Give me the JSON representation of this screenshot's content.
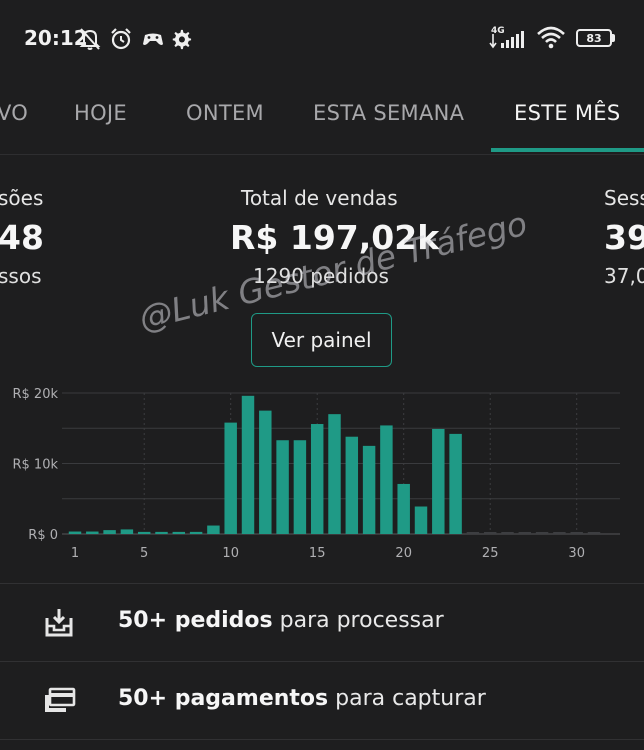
{
  "status_bar": {
    "time": "20:12",
    "icons": [
      "bell-off-icon",
      "alarm-icon",
      "game-controller-icon",
      "gear-icon"
    ],
    "right_icons": [
      "signal-4g-icon",
      "wifi-icon",
      "battery-icon"
    ],
    "network_label": "4G",
    "battery": "83"
  },
  "tabs": [
    {
      "label": "VO"
    },
    {
      "label": "HOJE"
    },
    {
      "label": "ONTEM"
    },
    {
      "label": "ESTA SEMANA"
    },
    {
      "label": "ESTE MÊS",
      "active": true
    }
  ],
  "metrics": {
    "left": {
      "label": "sões",
      "value": "48",
      "sub": "ssos"
    },
    "center": {
      "label": "Total de vendas",
      "value": "R$ 197,02k",
      "sub": "1290 pedidos"
    },
    "right": {
      "label": "Sess",
      "value": "39",
      "sub": "37,0"
    }
  },
  "view_panel_label": "Ver painel",
  "watermark": "@Luk Gestor de Tráfego",
  "accent_color": "#1f9a86",
  "chart_data": {
    "type": "bar",
    "categories": [
      1,
      2,
      3,
      4,
      5,
      6,
      7,
      8,
      9,
      10,
      11,
      12,
      13,
      14,
      15,
      16,
      17,
      18,
      19,
      20,
      21,
      22,
      23,
      24,
      25,
      26,
      27,
      28,
      29,
      30,
      31
    ],
    "values": [
      350,
      350,
      550,
      650,
      300,
      300,
      300,
      300,
      1200,
      15800,
      19600,
      17500,
      13300,
      13300,
      15600,
      17000,
      13800,
      12500,
      15400,
      7100,
      3900,
      14900,
      14200,
      0,
      0,
      0,
      0,
      0,
      0,
      0,
      0
    ],
    "ylim": [
      0,
      20000
    ],
    "yticks": [
      "R$ 0",
      "R$ 10k",
      "R$ 20k"
    ],
    "xticks": [
      "1",
      "5",
      "10",
      "15",
      "20",
      "25",
      "30"
    ],
    "xlabel": "",
    "ylabel": "",
    "grid": true,
    "color": "#1f9a86"
  },
  "tasks": [
    {
      "bold": "50+ pedidos",
      "rest": " para processar",
      "icon": "inbox-download-icon"
    },
    {
      "bold": "50+ pagamentos",
      "rest": " para capturar",
      "icon": "credit-cards-icon"
    }
  ]
}
